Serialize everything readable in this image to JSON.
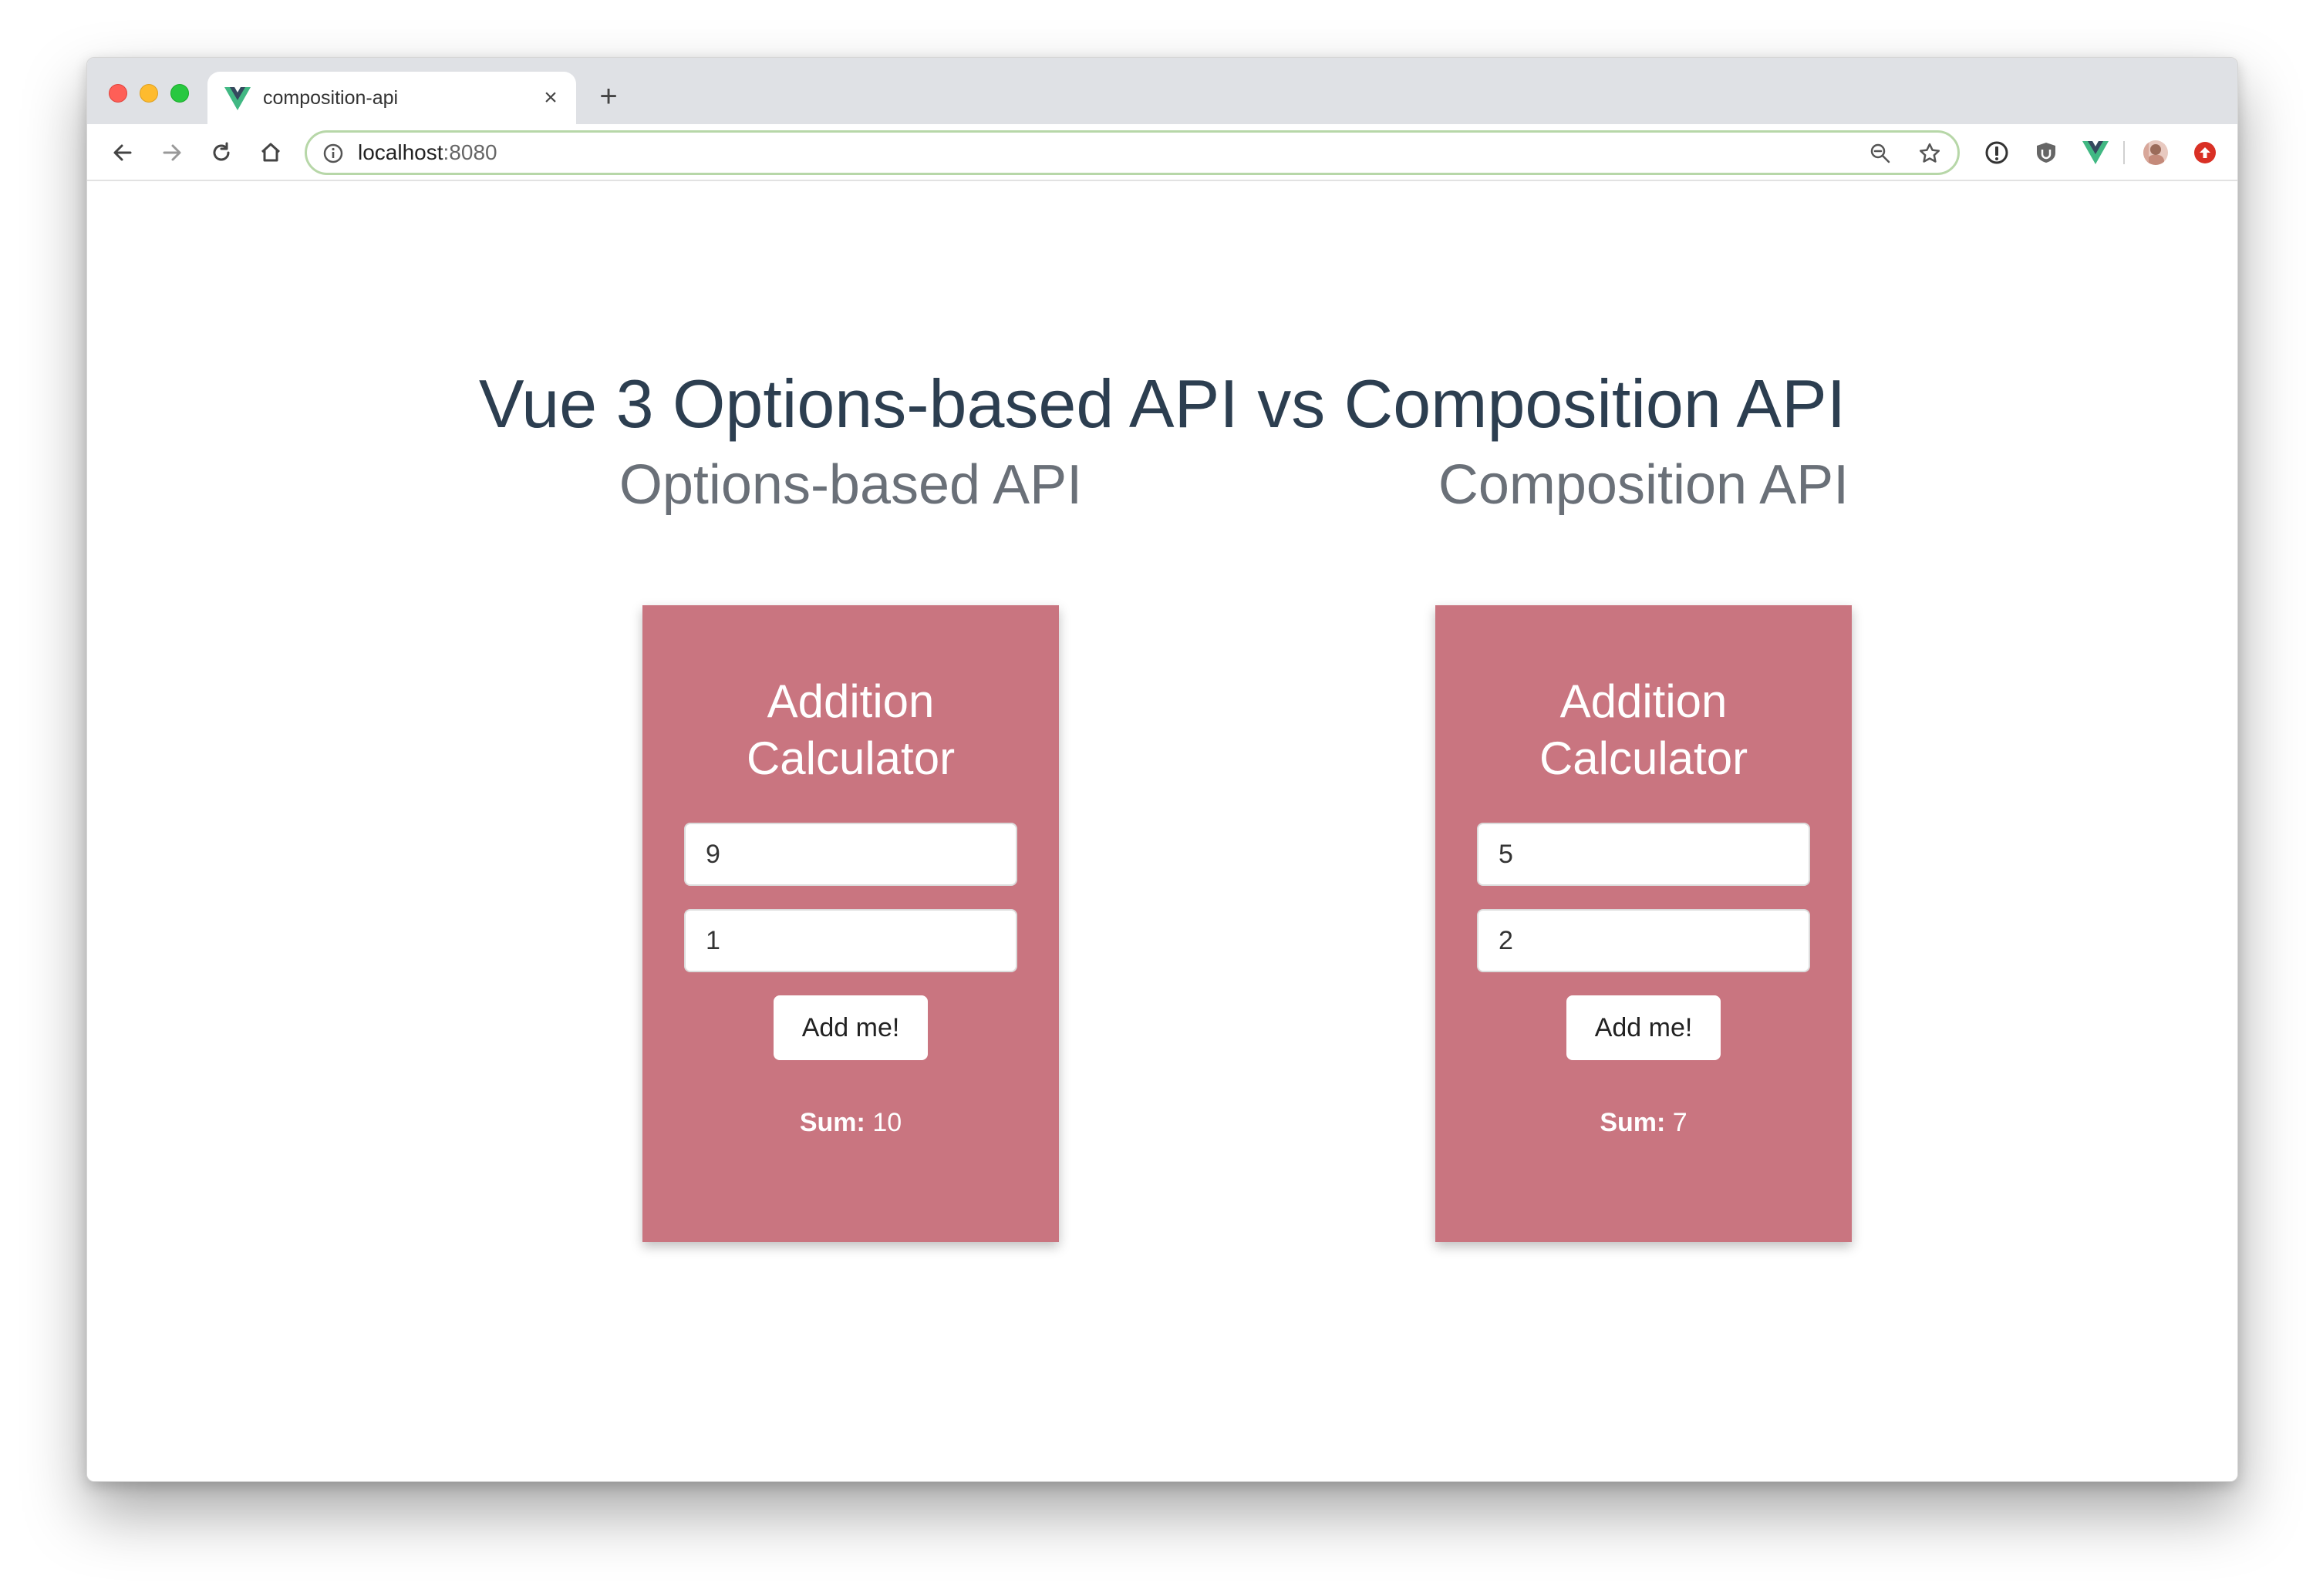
{
  "browser": {
    "tab_title": "composition-api",
    "tab_close": "×",
    "new_tab": "+",
    "url_host": "localhost",
    "url_port": ":8080",
    "icons": [
      "back-arrow-icon",
      "forward-arrow-icon",
      "reload-icon",
      "home-icon",
      "info-icon",
      "zoom-icon",
      "star-icon",
      "password-manager-icon",
      "shield-extension-icon",
      "vue-devtools-icon",
      "profile-avatar",
      "update-icon"
    ],
    "colors": {
      "tabbar": "#dfe1e5",
      "omnibox_border": "#b7d7a8",
      "vue_green": "#41b883",
      "vue_dark": "#35495e"
    }
  },
  "page": {
    "title": "Vue 3 Options-based API vs Composition API",
    "colors": {
      "title": "#2c3e50",
      "subtitle": "#6a7078",
      "card": "#c97580"
    },
    "columns": [
      {
        "heading": "Options-based API",
        "card_title_line1": "Addition",
        "card_title_line2": "Calculator",
        "input_a": "9",
        "input_b": "1",
        "button_label": "Add me!",
        "sum_label": "Sum:",
        "sum_value": "10"
      },
      {
        "heading": "Composition API",
        "card_title_line1": "Addition",
        "card_title_line2": "Calculator",
        "input_a": "5",
        "input_b": "2",
        "button_label": "Add me!",
        "sum_label": "Sum:",
        "sum_value": "7"
      }
    ]
  }
}
